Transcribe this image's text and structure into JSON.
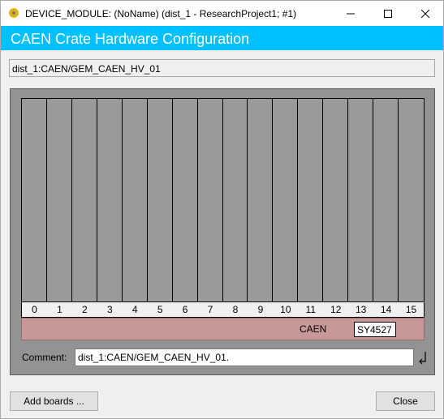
{
  "window": {
    "title": "DEVICE_MODULE: (NoName) (dist_1 - ResearchProject1; #1)"
  },
  "banner": {
    "title": "CAEN Crate Hardware Configuration",
    "color": "#00c0ff"
  },
  "path": {
    "value": "dist_1:CAEN/GEM_CAEN_HV_01"
  },
  "crate": {
    "slot_numbers": [
      "0",
      "1",
      "2",
      "3",
      "4",
      "5",
      "6",
      "7",
      "8",
      "9",
      "10",
      "11",
      "12",
      "13",
      "14",
      "15"
    ],
    "brand": "CAEN",
    "model": "SY4527",
    "bar_color": "#c89898",
    "panel_color": "#939393"
  },
  "comment": {
    "label": "Comment:",
    "value": "dist_1:CAEN/GEM_CAEN_HV_01."
  },
  "buttons": {
    "add_boards": "Add boards ...",
    "close": "Close"
  },
  "icons": {
    "app": "app-gear-icon",
    "minimize": "minimize-icon",
    "maximize": "maximize-icon",
    "close": "close-icon",
    "enter": "enter-return-icon"
  }
}
